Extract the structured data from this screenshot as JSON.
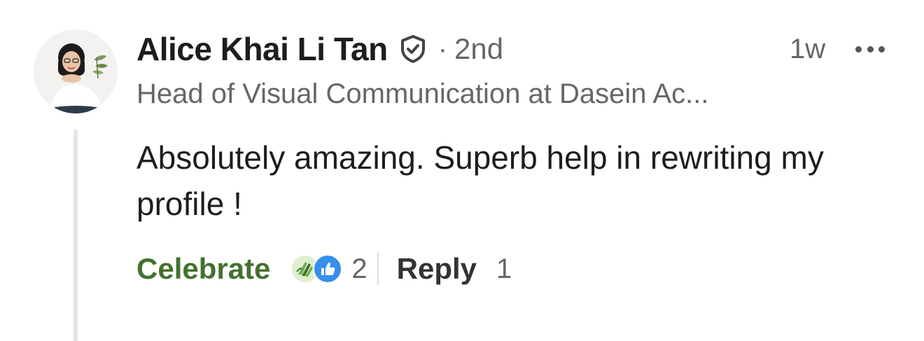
{
  "comment": {
    "author": {
      "name": "Alice Khai Li Tan",
      "connection_separator": "·",
      "degree": "2nd",
      "headline": "Head of Visual Communication at Dasein Ac...",
      "verified_icon": "verified-shield-icon",
      "avatar": "profile-photo"
    },
    "timestamp": "1w",
    "more_icon": "more-horizontal-icon",
    "text": "Absolutely amazing. Superb help in rewriting my profile !",
    "actions": {
      "celebrate_label": "Celebrate",
      "reaction_icons": [
        "celebrate-icon",
        "like-icon"
      ],
      "reaction_count": "2",
      "reply_label": "Reply",
      "reply_count": "1"
    }
  },
  "colors": {
    "celebrate_green": "#44712e",
    "text_primary": "#1d1d1d",
    "text_secondary": "#666666",
    "like_blue": "#378fe9",
    "thread_line": "#e9e5df"
  }
}
